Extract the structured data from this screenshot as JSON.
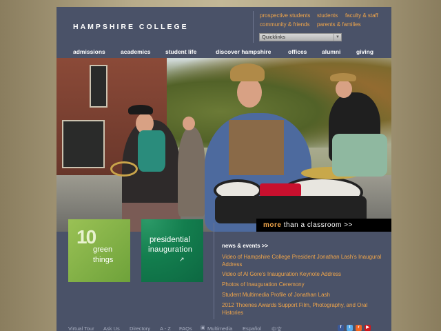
{
  "header": {
    "logo_text": "HAMPSHIRE COLLEGE",
    "audience_links": [
      "prospective students",
      "students",
      "faculty & staff",
      "community & friends",
      "parents & families"
    ],
    "quicklinks_label": "Quicklinks"
  },
  "nav": {
    "items": [
      "admissions",
      "academics",
      "student life",
      "discover hampshire",
      "offices",
      "alumni",
      "giving"
    ]
  },
  "hero": {
    "tagline_bold": "more",
    "tagline_rest": " than a classroom ",
    "tagline_arrow": ">>"
  },
  "tiles": {
    "tile1": {
      "num": "10",
      "line1": "green",
      "line2": "things"
    },
    "tile2": {
      "line1": "presidential",
      "line2": "inauguration",
      "ext": "↗"
    }
  },
  "news": {
    "title": "news & events >>",
    "items": [
      "Video of Hampshire College President Jonathan Lash's Inaugural Address",
      "Video of Al Gore's Inauguration Keynote Address",
      "Photos of Inauguration Ceremony",
      "Student Multimedia Profile of Jonathan Lash",
      "2012 Thoenes Awards Support Film, Photography, and Oral Histories"
    ]
  },
  "footer": {
    "links": [
      "Virtual Tour",
      "Ask Us",
      "Directory",
      "A - Z",
      "FAQs",
      "Multimedia",
      "Español",
      "中文"
    ],
    "social_icons": [
      "facebook-icon",
      "twitter-icon",
      "rss-icon",
      "youtube-icon"
    ]
  },
  "colors": {
    "page_bg": "#4a5268",
    "link_orange": "#f0a54a",
    "tile_green_light": "#7fb047",
    "tile_green_dark": "#137e4e"
  }
}
